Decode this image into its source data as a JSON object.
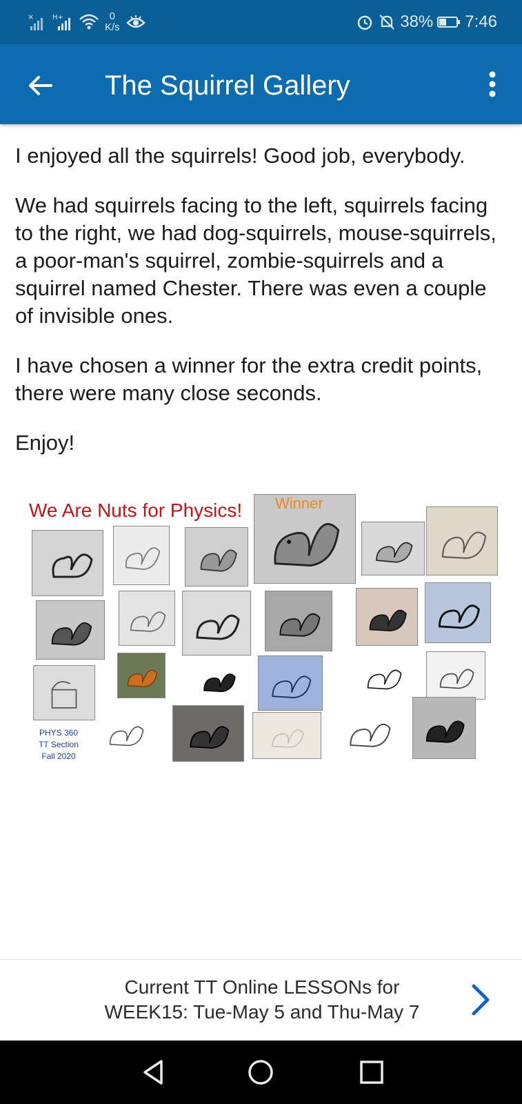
{
  "status_bar": {
    "net_speed_value": "0",
    "net_speed_unit": "K/s",
    "battery_percent": "38%",
    "battery_level": 0.38,
    "time": "7:46",
    "icons": [
      "no-signal-icon",
      "hplus-signal-icon",
      "wifi-icon",
      "eye-icon",
      "alarm-icon",
      "do-not-disturb-icon",
      "battery-icon"
    ]
  },
  "app_bar": {
    "title": "The Squirrel Gallery",
    "back_icon": "arrow-left-icon",
    "menu_icon": "more-vertical-icon"
  },
  "content": {
    "paragraphs": [
      "I enjoyed all the squirrels! Good job, everybody.",
      "We had squirrels facing to the left, squirrels facing to the right, we had dog-squirrels, mouse-squirrels, a poor-man's squirrel, zombie-squirrels and a squirrel named Chester. There was even a couple of invisible ones.",
      "I have chosen a winner for the extra credit points, there were many close seconds.",
      "Enjoy!"
    ]
  },
  "collage": {
    "title": "We Are Nuts for Physics!",
    "winner_label": "Winner",
    "caption_line1": "PHYS 360",
    "caption_line2": "TT Section",
    "caption_line3": "Fall 2020"
  },
  "lesson_link": {
    "line1": "Current TT Online LESSONs for",
    "line2": "WEEK15: Tue-May 5 and Thu-May 7",
    "icon": "chevron-right-icon",
    "accent": "#1565c0"
  },
  "nav_bar": {
    "icons": [
      "back-triangle-icon",
      "home-circle-icon",
      "recents-square-icon"
    ]
  },
  "colors": {
    "status_bar": "#0a5f97",
    "app_bar": "#0d6cb0",
    "collage_title": "#c4141a",
    "winner_label": "#e88a20"
  }
}
